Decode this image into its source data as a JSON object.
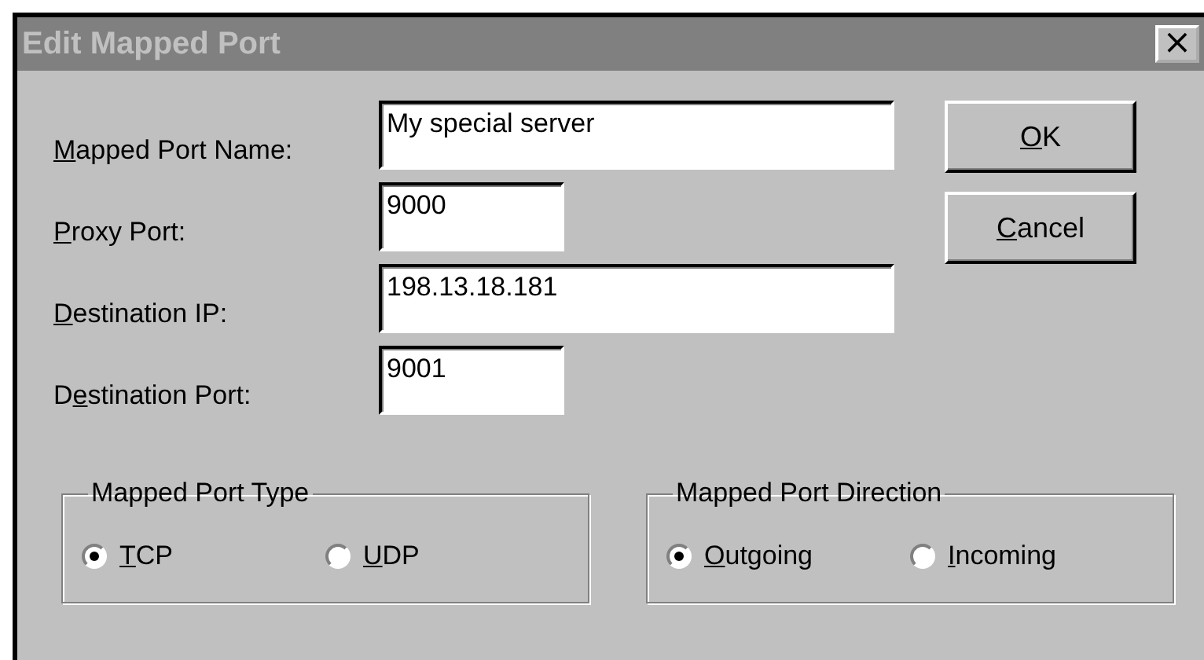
{
  "window": {
    "title": "Edit Mapped Port",
    "close": "×"
  },
  "fields": [
    {
      "label": {
        "mnemonic": "M",
        "after": "apped Port Name:"
      },
      "value": "My special server",
      "kind": "wide"
    },
    {
      "label": {
        "mnemonic": "P",
        "after": "roxy Port:"
      },
      "value": "9000",
      "kind": "short"
    },
    {
      "label": {
        "mnemonic": "D",
        "after": "estination IP:"
      },
      "value": "198.13.18.181",
      "kind": "wide"
    },
    {
      "label": {
        "before": "D",
        "mnemonic": "e",
        "after": "stination Port:"
      },
      "value": "9001",
      "kind": "short"
    }
  ],
  "buttons": [
    {
      "mnemonic": "O",
      "after": "K"
    },
    {
      "mnemonic": "C",
      "after": "ancel"
    }
  ],
  "groups": [
    {
      "title": "Mapped Port Type",
      "options": [
        {
          "label": {
            "mnemonic": "T",
            "after": "CP"
          },
          "selected": true
        },
        {
          "label": {
            "mnemonic": "U",
            "after": "DP"
          },
          "selected": false
        }
      ]
    },
    {
      "title": "Mapped Port Direction",
      "options": [
        {
          "label": {
            "mnemonic": "O",
            "after": "utgoing"
          },
          "selected": true
        },
        {
          "label": {
            "mnemonic": "I",
            "after": "ncoming"
          },
          "selected": false
        }
      ]
    }
  ]
}
